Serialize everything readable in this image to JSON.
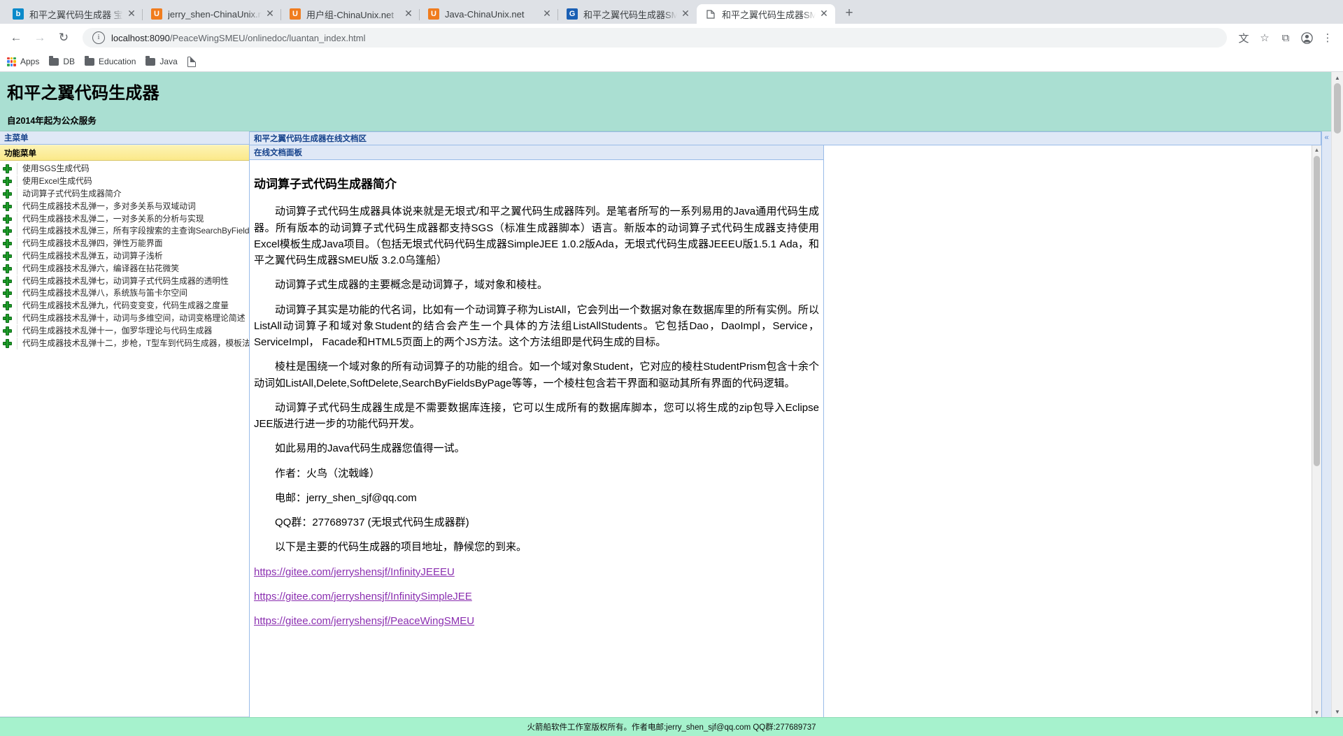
{
  "browser": {
    "tabs": [
      {
        "title": "和平之翼代码生成器 宝船",
        "favicon": "bing-icon",
        "active": false
      },
      {
        "title": "jerry_shen-ChinaUnix.net",
        "favicon": "chinaunix-icon",
        "active": false
      },
      {
        "title": "用户组-ChinaUnix.net",
        "favicon": "chinaunix-icon",
        "active": false
      },
      {
        "title": "Java-ChinaUnix.net",
        "favicon": "chinaunix-icon",
        "active": false
      },
      {
        "title": "和平之翼代码生成器SMEU",
        "favicon": "smeu-icon",
        "active": false
      },
      {
        "title": "和平之翼代码生成器SMEU",
        "favicon": "document-icon",
        "active": true
      }
    ],
    "new_tab_label": "+",
    "close_label": "✕",
    "nav": {
      "back": "←",
      "forward": "→",
      "reload": "↻",
      "info_icon": "ⓘ"
    },
    "url": {
      "host": "localhost:8090",
      "path": "/PeaceWingSMEU/onlinedoc/luantan_index.html"
    },
    "toolbar_icons": [
      {
        "name": "translate-icon",
        "glyph": "文"
      },
      {
        "name": "bookmark-star-icon",
        "glyph": "☆"
      },
      {
        "name": "extensions-icon",
        "glyph": "⧉"
      },
      {
        "name": "profile-icon",
        "glyph": "●"
      },
      {
        "name": "more-menu-icon",
        "glyph": "⋮"
      }
    ],
    "bookmarks": [
      {
        "label": "Apps",
        "icon": "apps-grid-icon"
      },
      {
        "label": "DB",
        "icon": "folder-icon"
      },
      {
        "label": "Education",
        "icon": "folder-icon"
      },
      {
        "label": "Java",
        "icon": "folder-icon"
      },
      {
        "label": "",
        "icon": "page-icon"
      }
    ]
  },
  "banner": {
    "title": "和平之翼代码生成器",
    "subtitle": "自2014年起为公众服务",
    "bg_color": "#aadfd2"
  },
  "sidebar": {
    "main_menu_title": "主菜单",
    "collapse_glyph": "«",
    "function_menu_title": "功能菜单",
    "expand_glyph": "«",
    "items": [
      {
        "label": "使用SGS生成代码"
      },
      {
        "label": "使用Excel生成代码"
      },
      {
        "label": "动词算子式代码生成器简介"
      },
      {
        "label": "代码生成器技术乱弹一，多对多关系与双域动词"
      },
      {
        "label": "代码生成器技术乱弹二，一对多关系的分析与实现"
      },
      {
        "label": "代码生成器技术乱弹三，所有字段搜索的主查询SearchByFieldsByPage"
      },
      {
        "label": "代码生成器技术乱弹四，弹性万能界面"
      },
      {
        "label": "代码生成器技术乱弹五，动词算子浅析"
      },
      {
        "label": "代码生成器技术乱弹六，编译器在拈花微笑"
      },
      {
        "label": "代码生成器技术乱弹七，动词算子式代码生成器的透明性"
      },
      {
        "label": "代码生成器技术乱弹八，系统族与笛卡尔空间"
      },
      {
        "label": "代码生成器技术乱弹九，代码变变变，代码生成器之度量"
      },
      {
        "label": "代码生成器技术乱弹十，动词与多维空间，动词变格理论简述"
      },
      {
        "label": "代码生成器技术乱弹十一，伽罗华理论与代码生成器"
      },
      {
        "label": "代码生成器技术乱弹十二，步枪，T型车到代码生成器，模板法的工业魔术"
      }
    ]
  },
  "center": {
    "region_title": "和平之翼代码生成器在线文档区",
    "panel_title": "在线文档面板",
    "east_collapse_glyph": "«"
  },
  "document": {
    "heading": "动词算子式代码生成器简介",
    "paragraphs": [
      "动词算子式代码生成器具体说来就是无垠式/和平之翼代码生成器阵列。是笔者所写的一系列易用的Java通用代码生成器。所有版本的动词算子式代码生成器都支持SGS（标准生成器脚本）语言。新版本的动词算子式代码生成器支持使用Excel模板生成Java项目。（包括无垠式代码代码生成器SimpleJEE 1.0.2版Ada，无垠式代码生成器JEEEU版1.5.1 Ada，和平之翼代码生成器SMEU版 3.2.0乌篷船）",
      "动词算子式生成器的主要概念是动词算子，域对象和棱柱。",
      "动词算子其实是功能的代名词，比如有一个动词算子称为ListAll，它会列出一个数据对象在数据库里的所有实例。所以ListAll动词算子和域对象Student的结合会产生一个具体的方法组ListAllStudents。它包括Dao，DaoImpl，Service，ServiceImpl， Facade和HTML5页面上的两个JS方法。这个方法组即是代码生成的目标。",
      "棱柱是围绕一个域对象的所有动词算子的功能的组合。如一个域对象Student，它对应的棱柱StudentPrism包含十余个动词如ListAll,Delete,SoftDelete,SearchByFieldsByPage等等，一个棱柱包含若干界面和驱动其所有界面的代码逻辑。",
      "动词算子式代码生成器生成是不需要数据库连接，它可以生成所有的数据库脚本，您可以将生成的zip包导入Eclipse JEE版进行进一步的功能代码开发。",
      "如此易用的Java代码生成器您值得一试。",
      "作者：火鸟（沈戟峰）",
      "电邮：jerry_shen_sjf@qq.com",
      "QQ群：277689737 (无垠式代码生成器群)",
      "以下是主要的代码生成器的项目地址，静候您的到来。"
    ],
    "links": [
      "https://gitee.com/jerryshensjf/InfinityJEEEU",
      "https://gitee.com/jerryshensjf/InfinitySimpleJEE",
      "https://gitee.com/jerryshensjf/PeaceWingSMEU"
    ],
    "link_color": "#8b2fb0"
  },
  "footer": {
    "text": "火箭船软件工作室版权所有。作者电邮:jerry_shen_sjf@qq.com QQ群:277689737",
    "bg_color": "#a6f2cd"
  },
  "scrollbars": {
    "up_glyph": "▲",
    "down_glyph": "▼"
  }
}
